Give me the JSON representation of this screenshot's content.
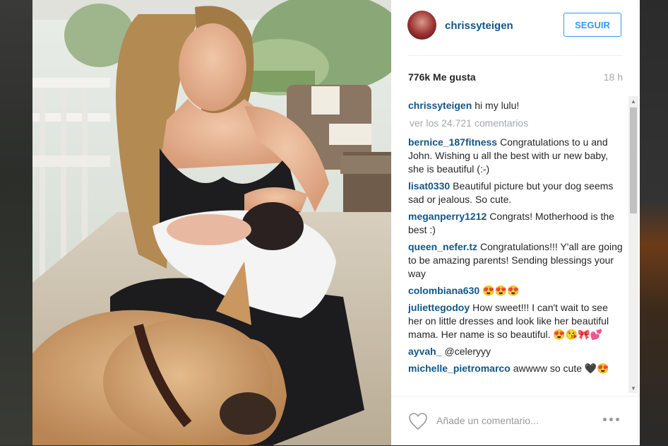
{
  "post": {
    "username": "chrissyteigen",
    "follow_label": "SEGUIR",
    "likes": "776k Me gusta",
    "time": "18 h",
    "caption_user": "chrissyteigen",
    "caption_text": "hi my lulu!",
    "view_all": "ver los 24.721 comentarios",
    "comments": [
      {
        "user": "bernice_187fitness",
        "text": "Congratulations to u and John. Wishing u all the best with ur new baby, she is beautiful (:-)"
      },
      {
        "user": "lisat0330",
        "text": "Beautiful picture but your dog seems sad or jealous. So cute."
      },
      {
        "user": "meganperry1212",
        "text": "Congrats! Motherhood is the best :)"
      },
      {
        "user": "queen_nefer.tz",
        "text": "Congratulations!!! Y'all are going to be amazing parents! Sending blessings your way"
      },
      {
        "user": "colombiana630",
        "text": "😍😍😍"
      },
      {
        "user": "juliettegodoy",
        "text": "How sweet!!! I can't wait to see her on little dresses and look like her beautiful mama. Her name is so beautiful. 😍😘🎀💕"
      },
      {
        "user": "ayvah_",
        "text": "@celeryyy"
      },
      {
        "user": "michelle_pietromarco",
        "text": "awwww so cute 🖤😍"
      }
    ],
    "comment_placeholder": "Añade un comentario...",
    "icons": {
      "like": "heart-icon",
      "more": "more-options-icon",
      "avatar": "profile-avatar"
    }
  },
  "colors": {
    "link": "#125688",
    "button": "#3897f0",
    "muted": "#a5a7aa"
  }
}
